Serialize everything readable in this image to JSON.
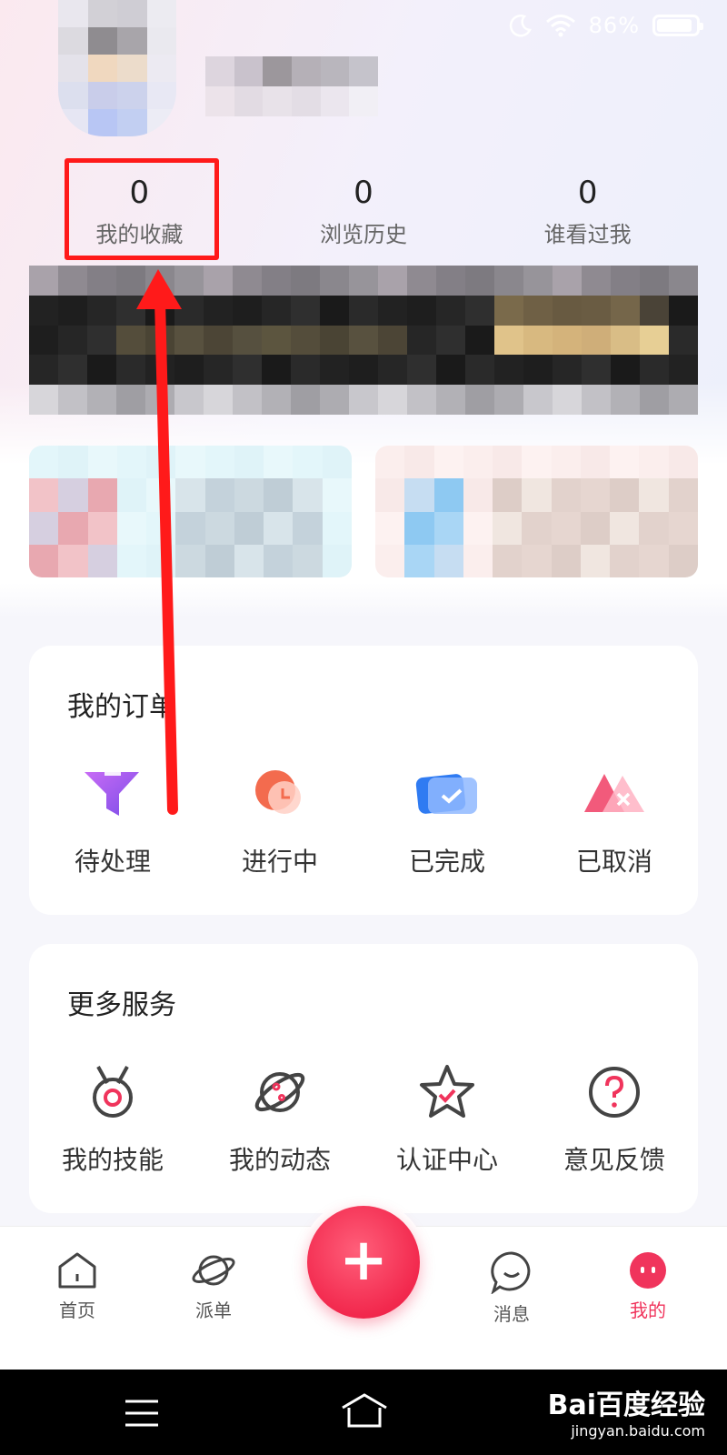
{
  "status_bar": {
    "battery_percent": "86%"
  },
  "stats": [
    {
      "count": "0",
      "label": "我的收藏"
    },
    {
      "count": "0",
      "label": "浏览历史"
    },
    {
      "count": "0",
      "label": "谁看过我"
    }
  ],
  "orders": {
    "title": "我的订单",
    "items": [
      {
        "label": "待处理",
        "icon": "funnel-icon"
      },
      {
        "label": "进行中",
        "icon": "clock-icon"
      },
      {
        "label": "已完成",
        "icon": "check-card-icon"
      },
      {
        "label": "已取消",
        "icon": "cancel-triangle-icon"
      }
    ]
  },
  "services": {
    "title": "更多服务",
    "items": [
      {
        "label": "我的技能",
        "icon": "medal-icon"
      },
      {
        "label": "我的动态",
        "icon": "planet-icon"
      },
      {
        "label": "认证中心",
        "icon": "star-icon"
      },
      {
        "label": "意见反馈",
        "icon": "question-icon"
      }
    ]
  },
  "tabbar": {
    "items": [
      {
        "label": "首页",
        "icon": "home-icon"
      },
      {
        "label": "派单",
        "icon": "planet-icon"
      },
      {
        "label": "消息",
        "icon": "chat-icon"
      },
      {
        "label": "我的",
        "icon": "profile-icon"
      }
    ],
    "fab_symbol": "+"
  },
  "watermark": {
    "main": "Bai百度经验",
    "sub": "jingyan.baidu.com"
  },
  "colors": {
    "accent": "#f0345c",
    "highlight": "#ff1a1a"
  }
}
